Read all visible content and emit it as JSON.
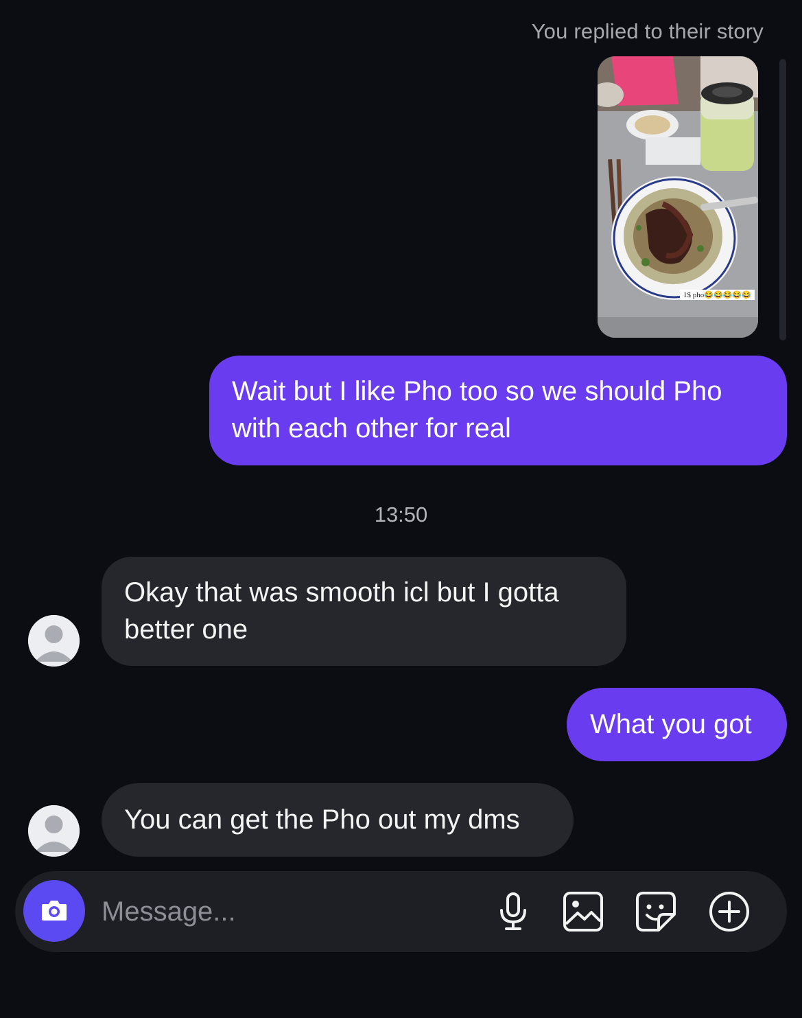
{
  "story": {
    "caption": "You replied to their story",
    "sticker_text": "1$ pho😂😂😂😂😂"
  },
  "messages": [
    {
      "side": "sent",
      "text_lines": [
        "Wait but I like Pho too so we should Pho",
        "with each other for real"
      ]
    },
    {
      "side": "received",
      "text_lines": [
        "Okay that was smooth icl but I gotta",
        "better one"
      ]
    },
    {
      "side": "sent",
      "text_lines": [
        "What you got"
      ]
    },
    {
      "side": "received",
      "text_lines": [
        "You can get the Pho out my dms"
      ]
    }
  ],
  "timestamp": "13:50",
  "composer": {
    "placeholder": "Message..."
  },
  "icons": {
    "camera": "camera-icon",
    "microphone": "microphone-icon",
    "gallery": "gallery-icon",
    "sticker": "sticker-icon",
    "add": "plus-circle-icon"
  },
  "colors": {
    "background": "#0b0d12",
    "sent_bubble": "#6a3cf0",
    "received_bubble": "#25272c",
    "camera_button": "#5b49f2"
  }
}
